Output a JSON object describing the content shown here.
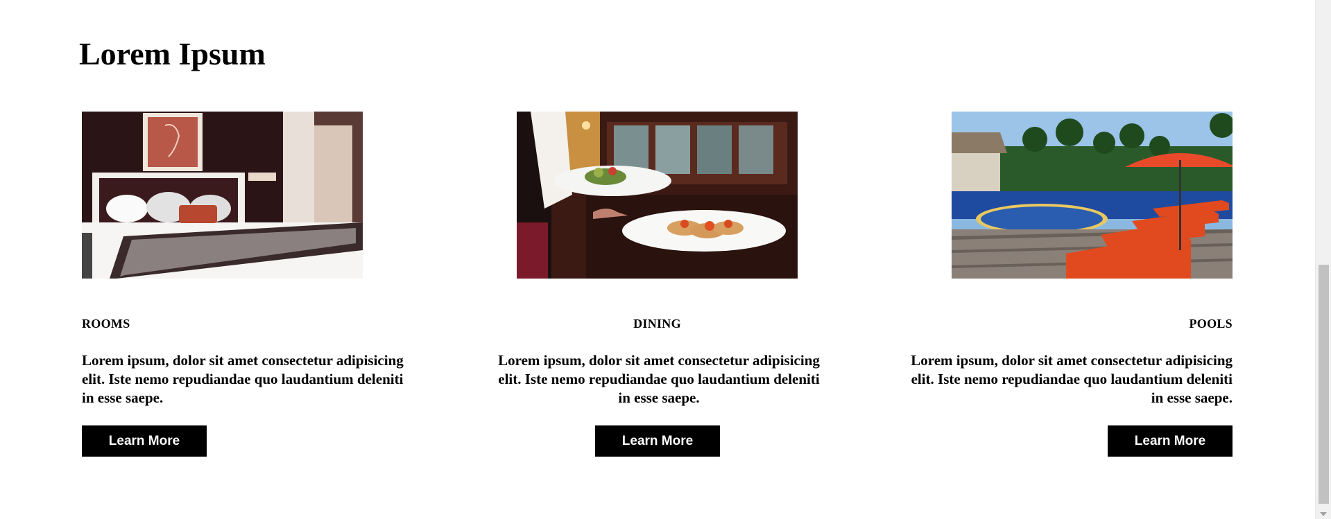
{
  "section": {
    "title": "Lorem Ipsum"
  },
  "cards": [
    {
      "title": "ROOMS",
      "image": "hotel-room-photo",
      "text": "Lorem ipsum, dolor sit amet consectetur adipisicing elit. Iste nemo repudiandae quo laudantium deleniti in esse saepe.",
      "button": "Learn More"
    },
    {
      "title": "DINING",
      "image": "dining-photo",
      "text": "Lorem ipsum, dolor sit amet consectetur adipisicing elit. Iste nemo repudiandae quo laudantium deleniti in esse saepe.",
      "button": "Learn More"
    },
    {
      "title": "POOLS",
      "image": "pool-photo",
      "text": "Lorem ipsum, dolor sit amet consectetur adipisicing elit. Iste nemo repudiandae quo laudantium deleniti in esse saepe.",
      "button": "Learn More"
    }
  ],
  "colors": {
    "button_bg": "#000000",
    "button_text": "#ffffff",
    "page_bg": "#ffffff"
  }
}
